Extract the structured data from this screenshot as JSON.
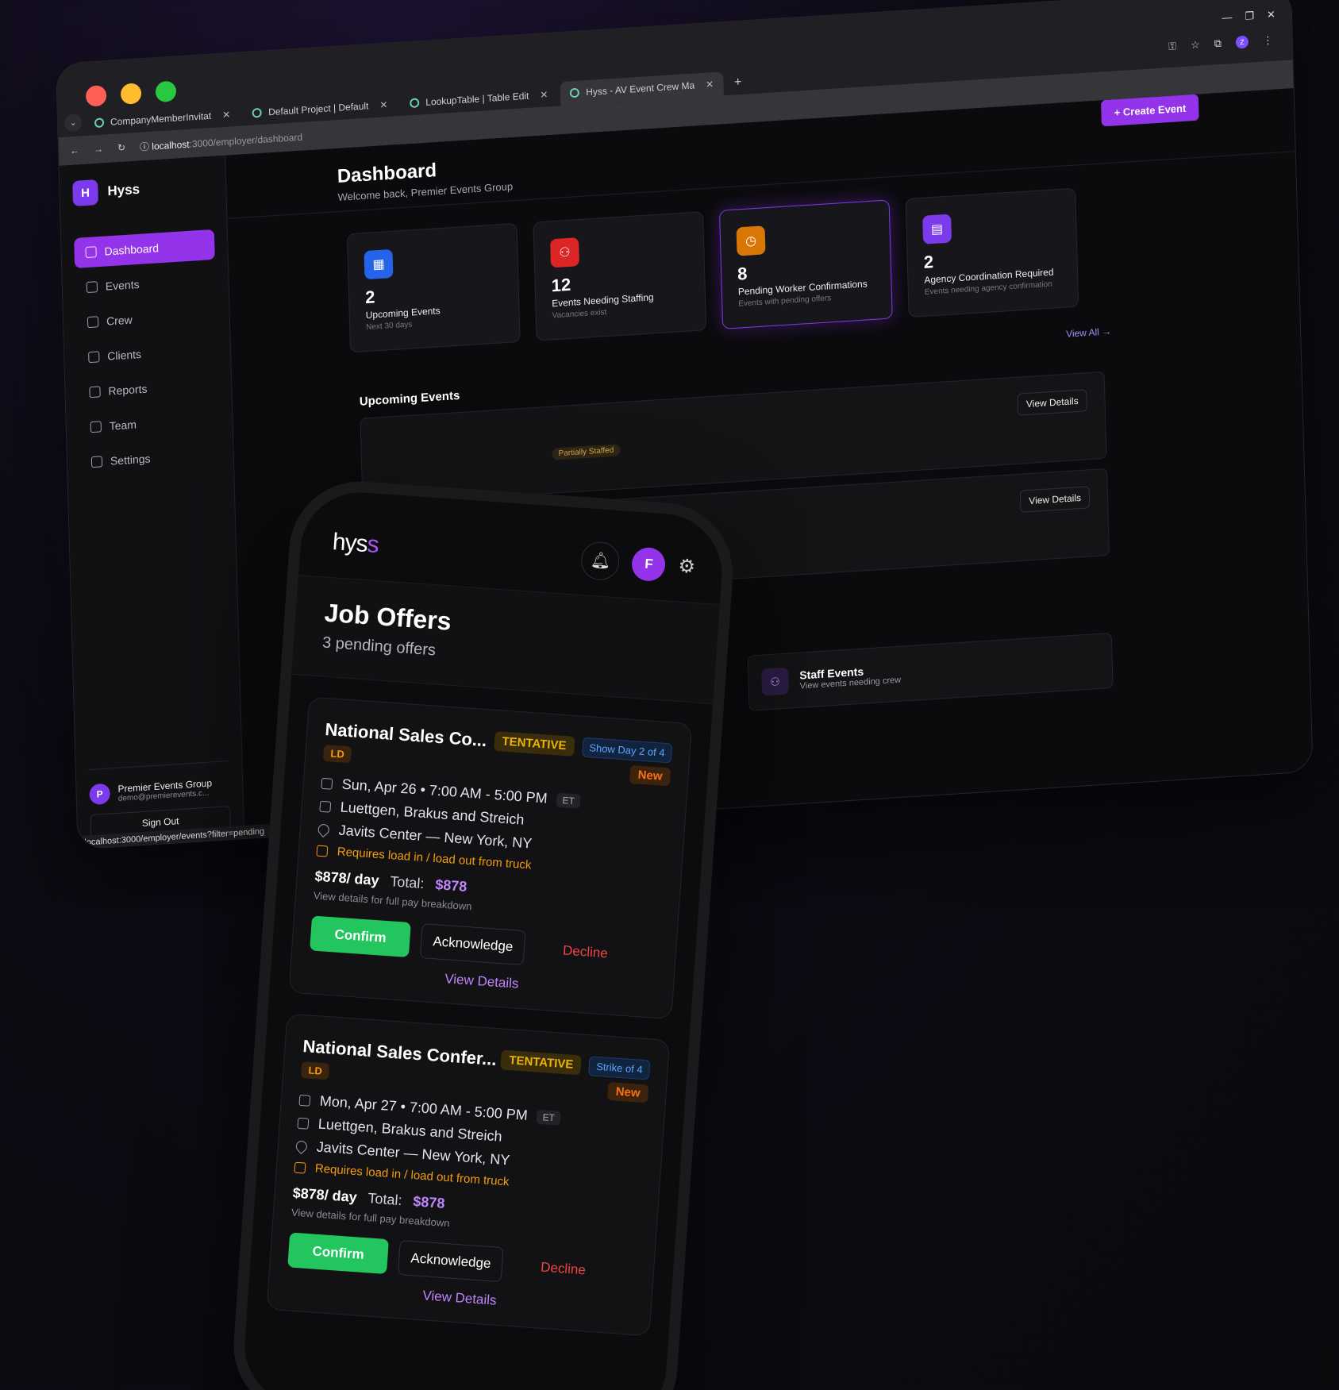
{
  "browser": {
    "tabs": [
      {
        "label": "CompanyMemberInvitat"
      },
      {
        "label": "Default Project | Default"
      },
      {
        "label": "LookupTable | Table Edit"
      },
      {
        "label": "Hyss - AV Event Crew Ma"
      }
    ],
    "url_host": "localhost",
    "url_path": ":3000/employer/dashboard",
    "status_url": "localhost:3000/employer/events?filter=pending"
  },
  "sidebar": {
    "brand": "Hyss",
    "brand_mark": "H",
    "items": [
      {
        "label": "Dashboard",
        "icon": "home-icon"
      },
      {
        "label": "Events",
        "icon": "calendar-icon"
      },
      {
        "label": "Crew",
        "icon": "users-icon"
      },
      {
        "label": "Clients",
        "icon": "building-icon"
      },
      {
        "label": "Reports",
        "icon": "chart-icon"
      },
      {
        "label": "Team",
        "icon": "team-icon"
      },
      {
        "label": "Settings",
        "icon": "gear-icon"
      }
    ],
    "user": {
      "initial": "P",
      "name": "Premier Events Group",
      "email": "demo@premierevents.c..."
    },
    "signout": "Sign Out"
  },
  "dashboard": {
    "title": "Dashboard",
    "subtitle": "Welcome back, Premier Events Group",
    "create_label": "+ Create Event",
    "stats": [
      {
        "value": "2",
        "label": "Upcoming Events",
        "sub": "Next 30 days",
        "color": "#2563eb"
      },
      {
        "value": "12",
        "label": "Events Needing Staffing",
        "sub": "Vacancies exist",
        "color": "#dc2626"
      },
      {
        "value": "8",
        "label": "Pending Worker Confirmations",
        "sub": "Events with pending offers",
        "color": "#d97706"
      },
      {
        "value": "2",
        "label": "Agency Coordination Required",
        "sub": "Events needing agency confirmation",
        "color": "#7c3aed"
      }
    ],
    "view_all": "View All →",
    "upcoming_title": "Upcoming Events",
    "partial_badge": "Partially Staffed",
    "view_details": "View Details",
    "staff_title": "Staff Events",
    "staff_sub": "View events needing crew"
  },
  "phone": {
    "logo_main": "hys",
    "logo_accent": "s",
    "avatar": "F",
    "title": "Job Offers",
    "subtitle": "3 pending offers",
    "offers": [
      {
        "name": "National Sales Co...",
        "dept": "LD",
        "status": "TENTATIVE",
        "day": "Show Day 2 of 4",
        "new": "New",
        "date": "Sun, Apr 26 • 7:00 AM - 5:00 PM",
        "tz": "ET",
        "client": "Luettgen, Brakus and Streich",
        "venue": "Javits Center — New York, NY",
        "req": "Requires load in / load out from truck",
        "rate": "$878/ day",
        "total_label": "Total:",
        "total": "$878",
        "note": "View details for full pay breakdown",
        "confirm": "Confirm",
        "ack": "Acknowledge",
        "decline": "Decline",
        "details": "View Details"
      },
      {
        "name": "National Sales Confer...",
        "dept": "LD",
        "status": "TENTATIVE",
        "day": "Strike of 4",
        "new": "New",
        "date": "Mon, Apr 27 • 7:00 AM - 5:00 PM",
        "tz": "ET",
        "client": "Luettgen, Brakus and Streich",
        "venue": "Javits Center — New York, NY",
        "req": "Requires load in / load out from truck",
        "rate": "$878/ day",
        "total_label": "Total:",
        "total": "$878",
        "note": "View details for full pay breakdown",
        "confirm": "Confirm",
        "ack": "Acknowledge",
        "decline": "Decline",
        "details": "View Details"
      }
    ]
  }
}
